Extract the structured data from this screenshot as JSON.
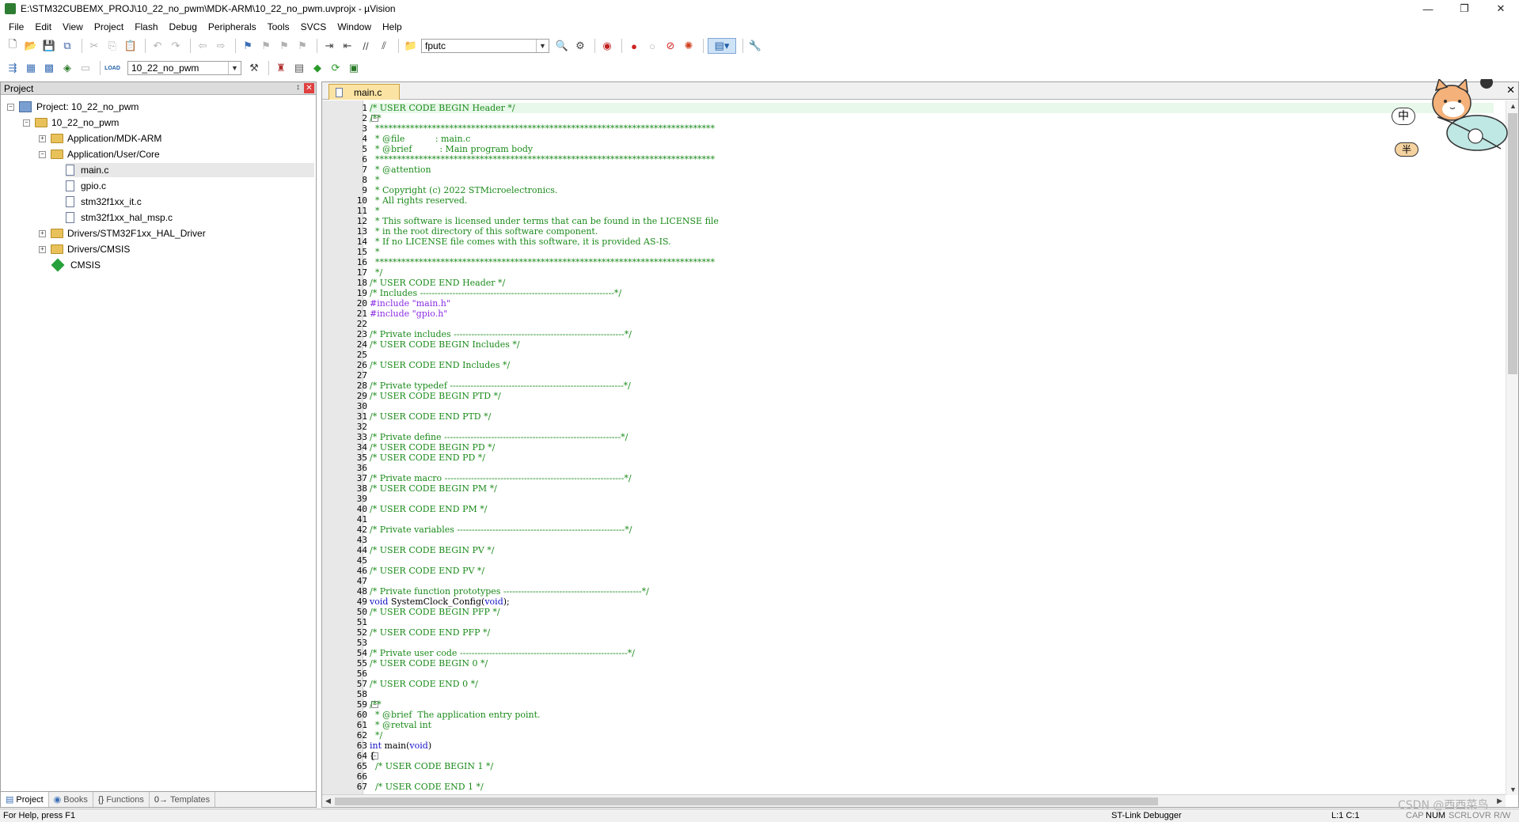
{
  "window": {
    "title": "E:\\STM32CUBEMX_PROJ\\10_22_no_pwm\\MDK-ARM\\10_22_no_pwm.uvprojx - µVision",
    "minimize": "—",
    "maximize": "❐",
    "close": "✕"
  },
  "menu": [
    "File",
    "Edit",
    "View",
    "Project",
    "Flash",
    "Debug",
    "Peripherals",
    "Tools",
    "SVCS",
    "Window",
    "Help"
  ],
  "toolbar": {
    "find_value": "fputc",
    "target_value": "10_22_no_pwm",
    "load_label": "LOAD"
  },
  "project_panel": {
    "title": "Project",
    "pin": "↕",
    "close": "✕",
    "tree": [
      {
        "label": "Project: 10_22_no_pwm",
        "kind": "project",
        "expander": "−"
      },
      {
        "label": "10_22_no_pwm",
        "kind": "target",
        "expander": "−"
      },
      {
        "label": "Application/MDK-ARM",
        "kind": "folder",
        "expander": "+"
      },
      {
        "label": "Application/User/Core",
        "kind": "folder",
        "expander": "−"
      },
      {
        "label": "main.c",
        "kind": "file"
      },
      {
        "label": "gpio.c",
        "kind": "file"
      },
      {
        "label": "stm32f1xx_it.c",
        "kind": "file"
      },
      {
        "label": "stm32f1xx_hal_msp.c",
        "kind": "file"
      },
      {
        "label": "Drivers/STM32F1xx_HAL_Driver",
        "kind": "folder",
        "expander": "+"
      },
      {
        "label": "Drivers/CMSIS",
        "kind": "folder",
        "expander": "+"
      },
      {
        "label": "CMSIS",
        "kind": "cmsis"
      }
    ],
    "tabs": [
      "Project",
      "Books",
      "Functions",
      "Templates"
    ],
    "tab_icons": [
      "▤",
      "◉",
      "{}",
      "0→"
    ]
  },
  "editor": {
    "tab_label": "main.c",
    "close_label": "✕",
    "lines": [
      {
        "n": "1",
        "parts": [
          [
            "c-com",
            "/* USER CODE BEGIN Header */"
          ]
        ]
      },
      {
        "n": "2",
        "parts": [
          [
            "c-com",
            "/**"
          ]
        ],
        "fold": "−"
      },
      {
        "n": "3",
        "parts": [
          [
            "c-com",
            "  ******************************************************************************"
          ]
        ]
      },
      {
        "n": "4",
        "parts": [
          [
            "c-com",
            "  * @file           : main.c"
          ]
        ]
      },
      {
        "n": "5",
        "parts": [
          [
            "c-com",
            "  * @brief          : Main program body"
          ]
        ]
      },
      {
        "n": "6",
        "parts": [
          [
            "c-com",
            "  ******************************************************************************"
          ]
        ]
      },
      {
        "n": "7",
        "parts": [
          [
            "c-com",
            "  * @attention"
          ]
        ]
      },
      {
        "n": "8",
        "parts": [
          [
            "c-com",
            "  *"
          ]
        ]
      },
      {
        "n": "9",
        "parts": [
          [
            "c-com",
            "  * Copyright (c) 2022 STMicroelectronics."
          ]
        ]
      },
      {
        "n": "10",
        "parts": [
          [
            "c-com",
            "  * All rights reserved."
          ]
        ]
      },
      {
        "n": "11",
        "parts": [
          [
            "c-com",
            "  *"
          ]
        ]
      },
      {
        "n": "12",
        "parts": [
          [
            "c-com",
            "  * This software is licensed under terms that can be found in the LICENSE file"
          ]
        ]
      },
      {
        "n": "13",
        "parts": [
          [
            "c-com",
            "  * in the root directory of this software component."
          ]
        ]
      },
      {
        "n": "14",
        "parts": [
          [
            "c-com",
            "  * If no LICENSE file comes with this software, it is provided AS-IS."
          ]
        ]
      },
      {
        "n": "15",
        "parts": [
          [
            "c-com",
            "  *"
          ]
        ]
      },
      {
        "n": "16",
        "parts": [
          [
            "c-com",
            "  ******************************************************************************"
          ]
        ]
      },
      {
        "n": "17",
        "parts": [
          [
            "c-com",
            "  */"
          ]
        ]
      },
      {
        "n": "18",
        "parts": [
          [
            "c-com",
            "/* USER CODE END Header */"
          ]
        ]
      },
      {
        "n": "19",
        "parts": [
          [
            "c-com",
            "/* Includes ------------------------------------------------------------------*/"
          ]
        ]
      },
      {
        "n": "20",
        "parts": [
          [
            "c-pre",
            "#include "
          ],
          [
            "c-str",
            "\"main.h\""
          ]
        ]
      },
      {
        "n": "21",
        "parts": [
          [
            "c-pre",
            "#include "
          ],
          [
            "c-str",
            "\"gpio.h\""
          ]
        ]
      },
      {
        "n": "22",
        "parts": []
      },
      {
        "n": "23",
        "parts": [
          [
            "c-com",
            "/* Private includes ----------------------------------------------------------*/"
          ]
        ]
      },
      {
        "n": "24",
        "parts": [
          [
            "c-com",
            "/* USER CODE BEGIN Includes */"
          ]
        ]
      },
      {
        "n": "25",
        "parts": []
      },
      {
        "n": "26",
        "parts": [
          [
            "c-com",
            "/* USER CODE END Includes */"
          ]
        ]
      },
      {
        "n": "27",
        "parts": []
      },
      {
        "n": "28",
        "parts": [
          [
            "c-com",
            "/* Private typedef -----------------------------------------------------------*/"
          ]
        ]
      },
      {
        "n": "29",
        "parts": [
          [
            "c-com",
            "/* USER CODE BEGIN PTD */"
          ]
        ]
      },
      {
        "n": "30",
        "parts": []
      },
      {
        "n": "31",
        "parts": [
          [
            "c-com",
            "/* USER CODE END PTD */"
          ]
        ]
      },
      {
        "n": "32",
        "parts": []
      },
      {
        "n": "33",
        "parts": [
          [
            "c-com",
            "/* Private define ------------------------------------------------------------*/"
          ]
        ]
      },
      {
        "n": "34",
        "parts": [
          [
            "c-com",
            "/* USER CODE BEGIN PD */"
          ]
        ]
      },
      {
        "n": "35",
        "parts": [
          [
            "c-com",
            "/* USER CODE END PD */"
          ]
        ]
      },
      {
        "n": "36",
        "parts": []
      },
      {
        "n": "37",
        "parts": [
          [
            "c-com",
            "/* Private macro -------------------------------------------------------------*/"
          ]
        ]
      },
      {
        "n": "38",
        "parts": [
          [
            "c-com",
            "/* USER CODE BEGIN PM */"
          ]
        ]
      },
      {
        "n": "39",
        "parts": []
      },
      {
        "n": "40",
        "parts": [
          [
            "c-com",
            "/* USER CODE END PM */"
          ]
        ]
      },
      {
        "n": "41",
        "parts": []
      },
      {
        "n": "42",
        "parts": [
          [
            "c-com",
            "/* Private variables ---------------------------------------------------------*/"
          ]
        ]
      },
      {
        "n": "43",
        "parts": []
      },
      {
        "n": "44",
        "parts": [
          [
            "c-com",
            "/* USER CODE BEGIN PV */"
          ]
        ]
      },
      {
        "n": "45",
        "parts": []
      },
      {
        "n": "46",
        "parts": [
          [
            "c-com",
            "/* USER CODE END PV */"
          ]
        ]
      },
      {
        "n": "47",
        "parts": []
      },
      {
        "n": "48",
        "parts": [
          [
            "c-com",
            "/* Private function prototypes -----------------------------------------------*/"
          ]
        ]
      },
      {
        "n": "49",
        "parts": [
          [
            "c-kw",
            "void "
          ],
          [
            "c-norm",
            "SystemClock_Config("
          ],
          [
            "c-kw",
            "void"
          ],
          [
            "c-norm",
            ");"
          ]
        ]
      },
      {
        "n": "50",
        "parts": [
          [
            "c-com",
            "/* USER CODE BEGIN PFP */"
          ]
        ]
      },
      {
        "n": "51",
        "parts": []
      },
      {
        "n": "52",
        "parts": [
          [
            "c-com",
            "/* USER CODE END PFP */"
          ]
        ]
      },
      {
        "n": "53",
        "parts": []
      },
      {
        "n": "54",
        "parts": [
          [
            "c-com",
            "/* Private user code ---------------------------------------------------------*/"
          ]
        ]
      },
      {
        "n": "55",
        "parts": [
          [
            "c-com",
            "/* USER CODE BEGIN 0 */"
          ]
        ]
      },
      {
        "n": "56",
        "parts": []
      },
      {
        "n": "57",
        "parts": [
          [
            "c-com",
            "/* USER CODE END 0 */"
          ]
        ]
      },
      {
        "n": "58",
        "parts": []
      },
      {
        "n": "59",
        "parts": [
          [
            "c-com",
            "/**"
          ]
        ],
        "fold": "−"
      },
      {
        "n": "60",
        "parts": [
          [
            "c-com",
            "  * @brief  The application entry point."
          ]
        ]
      },
      {
        "n": "61",
        "parts": [
          [
            "c-com",
            "  * @retval int"
          ]
        ]
      },
      {
        "n": "62",
        "parts": [
          [
            "c-com",
            "  */"
          ]
        ]
      },
      {
        "n": "63",
        "parts": [
          [
            "c-kw",
            "int "
          ],
          [
            "c-norm",
            "main("
          ],
          [
            "c-kw",
            "void"
          ],
          [
            "c-norm",
            ")"
          ]
        ]
      },
      {
        "n": "64",
        "parts": [
          [
            "c-norm",
            "{"
          ]
        ],
        "fold": "−"
      },
      {
        "n": "65",
        "parts": [
          [
            "c-com",
            "  /* USER CODE BEGIN 1 */"
          ]
        ]
      },
      {
        "n": "66",
        "parts": []
      },
      {
        "n": "67",
        "parts": [
          [
            "c-com",
            "  /* USER CODE END 1 */"
          ]
        ]
      }
    ]
  },
  "mascot": {
    "badge_top": "中",
    "badge_bottom": "半",
    "accent": "#f4b27a"
  },
  "status": {
    "help": "For Help, press F1",
    "debugger": "ST-Link Debugger",
    "position": "L:1 C:1",
    "cap": "CAP",
    "num": "NUM",
    "scrl": "SCRL",
    "ovr": "OVR",
    "rw": "R/W",
    "watermark": "CSDN @西西菜鸟"
  },
  "colors": {
    "comment": "#1a8a1a",
    "preprocessor": "#8a2be2",
    "keyword": "#1010c8",
    "current_line": "#e8f8ea",
    "tab_active": "#fbe3a4"
  }
}
